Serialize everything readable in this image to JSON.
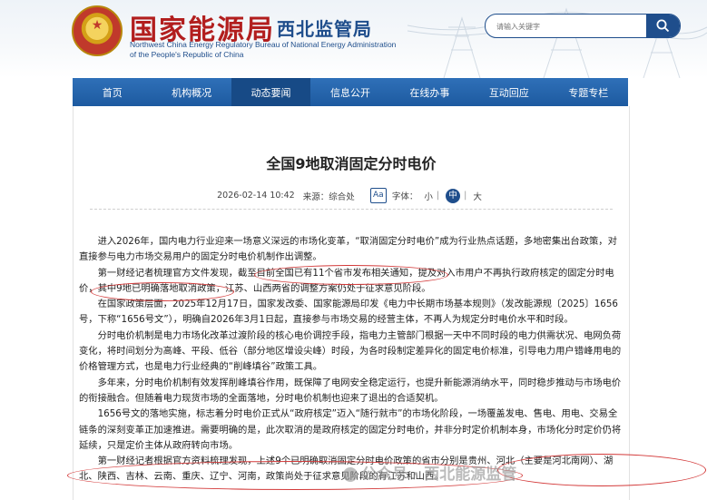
{
  "header": {
    "title": "国家能源局",
    "branch": "西北监管局",
    "en_line1": "Northwest China Energy Regulatory Bureau of National Energy Administration",
    "en_line2": "of the People's Republic of China",
    "emblem_icon": "national-emblem-icon"
  },
  "search": {
    "placeholder": "请输入关键字",
    "button_icon": "search-icon"
  },
  "nav": {
    "items": [
      "首页",
      "机构概况",
      "动态要闻",
      "信息公开",
      "在线办事",
      "互动回应",
      "专题专栏"
    ],
    "active_index": 2
  },
  "article": {
    "title": "全国9地取消固定分时电价",
    "date": "2026-02-14 10:42",
    "source": "来源：综合处",
    "font_label": "字体：",
    "font_icon_text": "Aa",
    "font_small": "小",
    "font_medium": "中",
    "font_large": "大",
    "paragraphs": [
      "进入2026年，国内电力行业迎来一场意义深远的市场化变革，“取消固定分时电价”成为行业热点话题，多地密集出台政策，对直接参与电力市场交易用户的固定分时电价机制作出调整。",
      "第一财经记者梳理官方文件发现，截至目前全国已有11个省市发布相关通知，提及对入市用户不再执行政府核定的固定分时电价，其中9地已明确落地取消政策，江苏、山西两省的调整方案仍处于征求意见阶段。",
      "在国家政策层面，2025年12月17日，国家发改委、国家能源局印发《电力中长期市场基本规则》（发改能源规〔2025〕1656号，下称“1656号文”），明确自2026年3月1日起，直接参与市场交易的经营主体，不再人为规定分时电价水平和时段。",
      "分时电价机制是电力市场化改革过渡阶段的核心电价调控手段，指电力主管部门根据一天中不同时段的电力供需状况、电网负荷变化，将时间划分为高峰、平段、低谷（部分地区增设尖峰）时段，为各时段制定差异化的固定电价标准，引导电力用户错峰用电的价格管理方式，也是电力行业经典的“削峰填谷”政策工具。",
      "多年来，分时电价机制有效发挥削峰填谷作用，既保障了电网安全稳定运行，也提升新能源消纳水平，同时稳步推动与市场电价的衔接融合。但随着电力现货市场的全面落地，分时电价机制也迎来了退出的合适契机。",
      "1656号文的落地实施，标志着分时电价正式从“政府核定”迈入“随行就市”的市场化阶段，一场覆盖发电、售电、用电、交易全链条的深刻变革正加速推进。需要明确的是，此次取消的是政府核定的固定分时电价，并非分时定价机制本身，市场化分时定价仍将延续，只是定价主体从政府转向市场。",
      "第一财经记者根据官方资料梳理发现，上述9个已明确取消固定分时电价政策的省市分别是贵州、河北（主要是河北南网）、湖北、陕西、吉林、云南、重庆、辽宁、河南，政策尚处于征求意见阶段的有江苏和山西。"
    ]
  },
  "watermark": "公众号 · 西北能源监管"
}
